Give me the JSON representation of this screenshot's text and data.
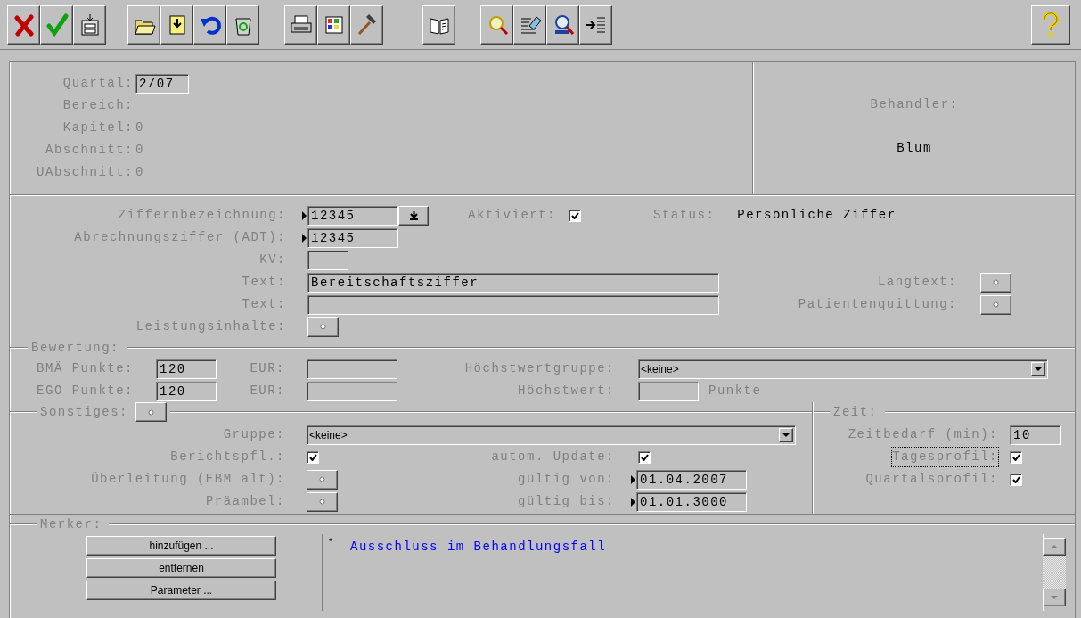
{
  "top_panel": {
    "fields": [
      {
        "label": "Quartal:",
        "value": "2/07",
        "kind": "input"
      },
      {
        "label": "Bereich:",
        "kind": "text"
      },
      {
        "label": "Kapitel:",
        "value": "0",
        "kind": "text"
      },
      {
        "label": "Abschnitt:",
        "value": "0",
        "kind": "text"
      },
      {
        "label": "UAbschnitt:",
        "value": "0",
        "kind": "text"
      }
    ],
    "behandler": {
      "label": "Behandler:",
      "value": "Blum"
    }
  },
  "ziffer_panel": {
    "ziffernbezeichnung": {
      "label": "Ziffernbezeichnung:",
      "value": "12345"
    },
    "aktiviert": {
      "label": "Aktiviert:",
      "checked": true
    },
    "status": {
      "label": "Status:",
      "value": "Persönliche Ziffer"
    },
    "abrechnungsziffer": {
      "label": "Abrechnungsziffer (ADT):",
      "value": "12345"
    },
    "kv": {
      "label": "KV:"
    },
    "text_1": {
      "label": "Text:",
      "value": "Bereitschaftsziffer"
    },
    "text_2": {
      "label": "Text:"
    },
    "langtext": {
      "label": "Langtext:"
    },
    "patientenquittung": {
      "label": "Patientenquittung:"
    },
    "leistungsinhalte": {
      "label": "Leistungsinhalte:"
    }
  },
  "bewertung": {
    "title": "Bewertung:",
    "bma_punkte": {
      "label": "BMÄ Punkte:",
      "value": "120"
    },
    "bma_eur": {
      "label": "EUR:"
    },
    "ego_punkte": {
      "label": "EGO Punkte:",
      "value": "120"
    },
    "ego_eur": {
      "label": "EUR:"
    },
    "hoechstwertgruppe": {
      "label": "Höchstwertgruppe:",
      "value": "<keine>"
    },
    "hoechstwert": {
      "label": "Höchstwert:",
      "unit": "Punkte"
    }
  },
  "sonstiges": {
    "title": "Sonstiges:",
    "gruppe": {
      "label": "Gruppe:",
      "value": "<keine>"
    },
    "berichtspfl": {
      "label": "Berichtspfl.:",
      "checked": true
    },
    "autom_update": {
      "label": "autom. Update:",
      "checked": true
    },
    "ueberleitung": {
      "label": "Überleitung (EBM alt):"
    },
    "gueltig_von": {
      "label": "gültig von:",
      "value": "01.04.2007"
    },
    "praeambel": {
      "label": "Präambel:"
    },
    "gueltig_bis": {
      "label": "gültig bis:",
      "value": "01.01.3000"
    }
  },
  "zeit": {
    "title": "Zeit:",
    "zeitbedarf": {
      "label": "Zeitbedarf (min):",
      "value": "10"
    },
    "tagesprofil": {
      "label": "Tagesprofil:",
      "checked": true,
      "focused": true
    },
    "quartalsprofil": {
      "label": "Quartalsprofil:",
      "checked": true
    }
  },
  "merker": {
    "title": "Merker:",
    "buttons": [
      "hinzufügen ...",
      "entfernen",
      "Parameter ..."
    ],
    "items": [
      {
        "mark": "*",
        "text": "Ausschluss im Behandlungsfall"
      }
    ]
  }
}
